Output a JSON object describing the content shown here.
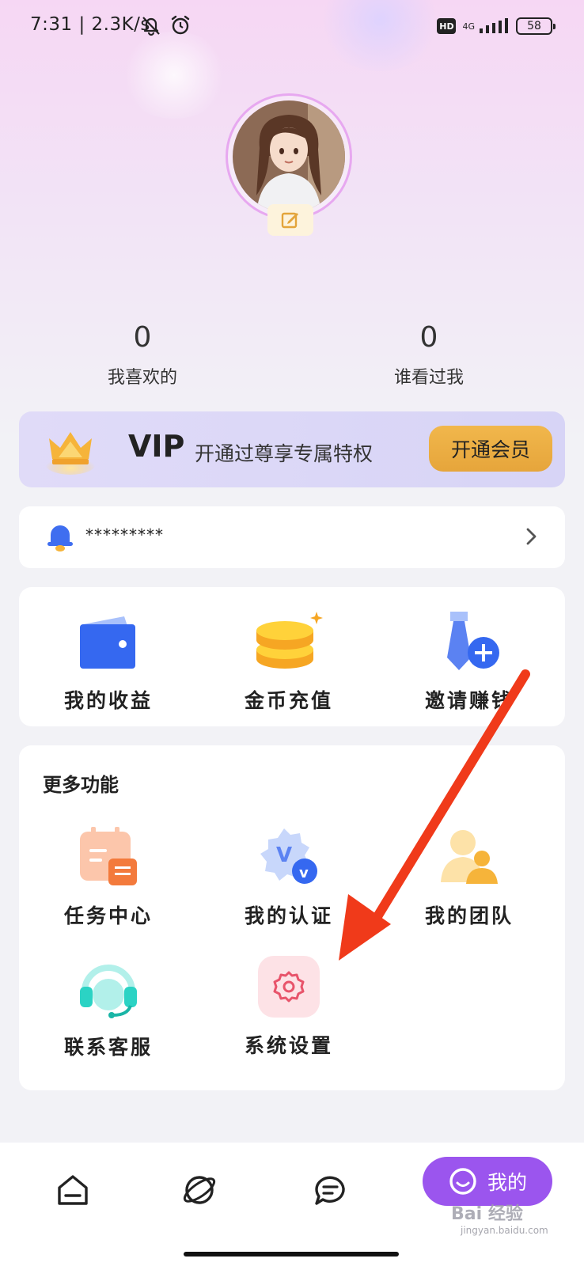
{
  "status_bar": {
    "time": "7:31 | 2.3K/s",
    "hd": "HD",
    "network": "4G",
    "battery": "58"
  },
  "profile": {
    "avatar": "avatar-image",
    "edit_icon": "edit-icon"
  },
  "stats": [
    {
      "value": "0",
      "label": "我喜欢的"
    },
    {
      "value": "0",
      "label": "谁看过我"
    }
  ],
  "vip": {
    "title": "VIP",
    "description": "开通过尊享专属特权",
    "button": "开通会员"
  },
  "notice": {
    "text": "*********"
  },
  "quick_actions": [
    {
      "label": "我的收益",
      "icon": "wallet-icon"
    },
    {
      "label": "金币充值",
      "icon": "coins-icon"
    },
    {
      "label": "邀请赚钱",
      "icon": "invite-icon"
    }
  ],
  "more_features": {
    "title": "更多功能",
    "items": [
      {
        "label": "任务中心",
        "icon": "task-calendar-icon"
      },
      {
        "label": "我的认证",
        "icon": "verified-badge-icon"
      },
      {
        "label": "我的团队",
        "icon": "team-icon"
      },
      {
        "label": "联系客服",
        "icon": "headset-icon"
      },
      {
        "label": "系统设置",
        "icon": "settings-gear-icon"
      }
    ]
  },
  "bottom_nav": {
    "items": [
      "home-icon",
      "planet-icon",
      "chat-icon"
    ],
    "active_label": "我的"
  },
  "watermark": {
    "main": "Bai 经验",
    "sub": "jingyan.baidu.com"
  },
  "colors": {
    "accent": "#9b55ee",
    "vip_button": "#e6a53b",
    "arrow": "#f03a1a"
  }
}
